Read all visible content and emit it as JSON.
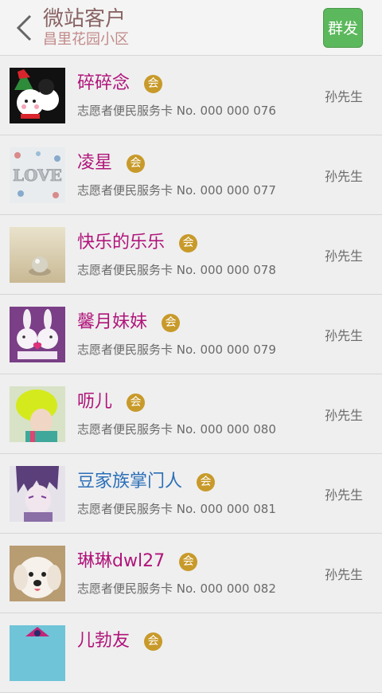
{
  "header": {
    "title": "微站客户",
    "subtitle": "昌里花园小区",
    "mass_send_label": "群发",
    "back_icon": "chevron-left-icon"
  },
  "colors": {
    "name_purple": "#b0147a",
    "name_blue": "#2b6fb8",
    "badge_gold": "#c89a2a",
    "mass_green": "#5cb85c"
  },
  "customers": [
    {
      "name": "碎碎念",
      "badge": "会",
      "card": "志愿者便民服务卡 No. 000 000 076",
      "agent": "孙先生"
    },
    {
      "name": "凌星",
      "badge": "会",
      "card": "志愿者便民服务卡 No. 000 000 077",
      "agent": "孙先生"
    },
    {
      "name": "快乐的乐乐",
      "badge": "会",
      "card": "志愿者便民服务卡 No. 000 000 078",
      "agent": "孙先生"
    },
    {
      "name": "馨月妹妹",
      "badge": "会",
      "card": "志愿者便民服务卡 No. 000 000 079",
      "agent": "孙先生"
    },
    {
      "name": "呖儿",
      "badge": "会",
      "card": "志愿者便民服务卡 No. 000 000 080",
      "agent": "孙先生"
    },
    {
      "name": "豆家族掌门人",
      "badge": "会",
      "card": "志愿者便民服务卡 No. 000 000 081",
      "agent": "孙先生"
    },
    {
      "name": "琳琳dwl27",
      "badge": "会",
      "card": "志愿者便民服务卡 No. 000 000 082",
      "agent": "孙先生"
    },
    {
      "name": "儿勃友",
      "badge": "会",
      "card": "",
      "agent": ""
    }
  ]
}
